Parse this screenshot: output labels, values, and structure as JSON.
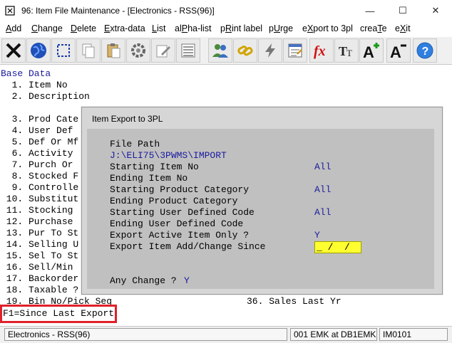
{
  "window": {
    "title": "96: Item File Maintenance - [Electronics - RSS(96)]",
    "minimize": "—",
    "maximize": "☐",
    "close": "✕"
  },
  "menu": [
    {
      "pre": "",
      "u": "A",
      "post": "dd"
    },
    {
      "pre": "",
      "u": "C",
      "post": "hange"
    },
    {
      "pre": "",
      "u": "D",
      "post": "elete"
    },
    {
      "pre": "",
      "u": "E",
      "post": "xtra-data"
    },
    {
      "pre": "",
      "u": "L",
      "post": "ist"
    },
    {
      "pre": "al",
      "u": "P",
      "post": "ha-list"
    },
    {
      "pre": "p",
      "u": "R",
      "post": "int label"
    },
    {
      "pre": "p",
      "u": "U",
      "post": "rge"
    },
    {
      "pre": "e",
      "u": "X",
      "post": "port to 3pl"
    },
    {
      "pre": "crea",
      "u": "T",
      "post": "e"
    },
    {
      "pre": "e",
      "u": "X",
      "post": "it"
    }
  ],
  "toolbar_icons": [
    "close-x-icon",
    "globe-icon",
    "select-box-icon",
    "copy-icon",
    "paste-icon",
    "settings-icon",
    "edit-icon",
    "list-icon",
    "users-icon",
    "link-icon",
    "lightning-icon",
    "form-icon",
    "function-fx-icon",
    "font-size-icon",
    "font-increase-icon",
    "font-decrease-icon",
    "help-icon"
  ],
  "terminal": {
    "heading": "Base Data",
    "lines": [
      "  1. Item No",
      "  2. Description",
      "",
      "  3. Prod Cate",
      "  4. User Def",
      "  5. Def Or Mf",
      "  6. Activity",
      "  7. Purch Or",
      "  8. Stocked F",
      "  9. Controlle",
      " 10. Substitut",
      " 11. Stocking",
      " 12. Purchase",
      " 13. Pur To St",
      " 14. Selling U",
      " 15. Sel To St",
      " 16. Sell/Min",
      " 17. Backorder",
      " 18. Taxable ?",
      " 19. Bin No/Pick Seq"
    ],
    "right_line": "36. Sales Last Yr"
  },
  "dialog": {
    "title": "Item Export to 3PL",
    "file_path_label": "File Path",
    "file_path": "J:\\ELI75\\3PWMS\\IMPORT",
    "fields": [
      {
        "label": "Starting Item No",
        "value": "All"
      },
      {
        "label": "Ending Item No",
        "value": ""
      },
      {
        "label": "Starting Product Category",
        "value": "All"
      },
      {
        "label": "Ending Product Category",
        "value": ""
      },
      {
        "label": "Starting User Defined Code",
        "value": "All"
      },
      {
        "label": "Ending User Defined Code",
        "value": ""
      },
      {
        "label": "Export Active Item Only ?",
        "value": "Y"
      }
    ],
    "date_label": "Export Item Add/Change Since",
    "date_value": "_ /  /",
    "any_change_label": "Any Change ? ",
    "any_change_value": "Y"
  },
  "fkey_hint": "F1=Since Last Export",
  "status": {
    "company": "Electronics - RSS(96)",
    "user": "001 EMK at DB1EMK",
    "screen": "IM0101"
  }
}
